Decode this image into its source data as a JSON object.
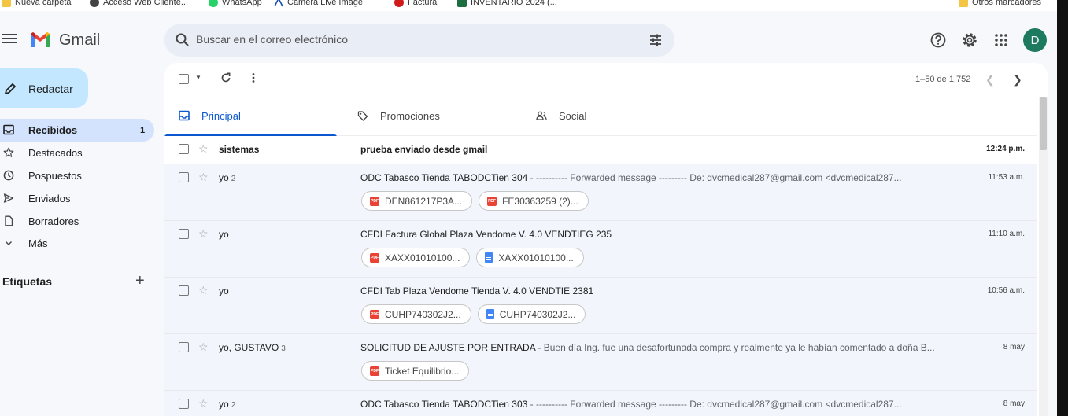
{
  "bookmarks": [
    {
      "label": "Nueva carpeta",
      "icon": "folder-icon"
    },
    {
      "label": "Acceso Web Cliente...",
      "icon": "globe-icon"
    },
    {
      "label": "WhatsApp",
      "icon": "whatsapp-icon"
    },
    {
      "label": "Camera Live Image",
      "icon": "camera-icon"
    },
    {
      "label": "Factura",
      "icon": "factura-icon"
    },
    {
      "label": "INVENTARIO 2024 (...",
      "icon": "excel-icon"
    }
  ],
  "other_bookmarks": "Otros marcadores",
  "app": {
    "name": "Gmail",
    "avatar_letter": "D",
    "accent": "#0b57d0"
  },
  "search": {
    "placeholder": "Buscar en el correo electrónico"
  },
  "compose": {
    "label": "Redactar"
  },
  "nav": [
    {
      "label": "Recibidos",
      "count": "1",
      "icon": "inbox-icon",
      "active": true
    },
    {
      "label": "Destacados",
      "count": "",
      "icon": "star-icon"
    },
    {
      "label": "Pospuestos",
      "count": "",
      "icon": "clock-icon"
    },
    {
      "label": "Enviados",
      "count": "",
      "icon": "send-icon"
    },
    {
      "label": "Borradores",
      "count": "",
      "icon": "draft-icon"
    },
    {
      "label": "Más",
      "count": "",
      "icon": "chevron-down-icon"
    }
  ],
  "labels_title": "Etiquetas",
  "toolbar": {
    "range": "1–50 de 1,752"
  },
  "tabs": [
    {
      "label": "Principal",
      "icon": "inbox-icon",
      "active": true
    },
    {
      "label": "Promociones",
      "icon": "tag-icon"
    },
    {
      "label": "Social",
      "icon": "people-icon"
    }
  ],
  "emails": [
    {
      "sender": "sistemas",
      "count": "",
      "subject": "prueba enviado desde gmail",
      "snippet": "",
      "time": "12:24 p.m.",
      "unread": true,
      "attachments": []
    },
    {
      "sender": "yo",
      "count": "2",
      "subject": "ODC Tabasco Tienda TABODCTien 304",
      "snippet": " - ---------- Forwarded message --------- De: dvcmedical287@gmail.com <dvcmedical287...",
      "time": "11:53 a.m.",
      "unread": false,
      "attachments": [
        {
          "name": "DEN861217P3A...",
          "type": "pdf"
        },
        {
          "name": "FE30363259 (2)...",
          "type": "pdf"
        }
      ]
    },
    {
      "sender": "yo",
      "count": "",
      "subject": "CFDI Factura Global Plaza Vendome V. 4.0 VENDTIEG 235",
      "snippet": "",
      "time": "11:10 a.m.",
      "unread": false,
      "attachments": [
        {
          "name": "XAXX01010100...",
          "type": "pdf"
        },
        {
          "name": "XAXX01010100...",
          "type": "doc"
        }
      ]
    },
    {
      "sender": "yo",
      "count": "",
      "subject": "CFDI Tab Plaza Vendome Tienda V. 4.0 VENDTIE 2381",
      "snippet": "",
      "time": "10:56 a.m.",
      "unread": false,
      "attachments": [
        {
          "name": "CUHP740302J2...",
          "type": "pdf"
        },
        {
          "name": "CUHP740302J2...",
          "type": "doc"
        }
      ]
    },
    {
      "sender": "yo, GUSTAVO",
      "count": "3",
      "subject": "SOLICITUD DE AJUSTE POR ENTRADA",
      "snippet": " - Buen día Ing. fue una desafortunada compra y realmente ya le habían comentado a doña B...",
      "time": "8 may",
      "unread": false,
      "attachments": [
        {
          "name": "Ticket Equilibrio...",
          "type": "pdf"
        }
      ]
    },
    {
      "sender": "yo",
      "count": "2",
      "subject": "ODC Tabasco Tienda TABODCTien 303",
      "snippet": " - ---------- Forwarded message --------- De: dvcmedical287@gmail.com <dvcmedical287...",
      "time": "8 may",
      "unread": false,
      "attachments": []
    }
  ]
}
